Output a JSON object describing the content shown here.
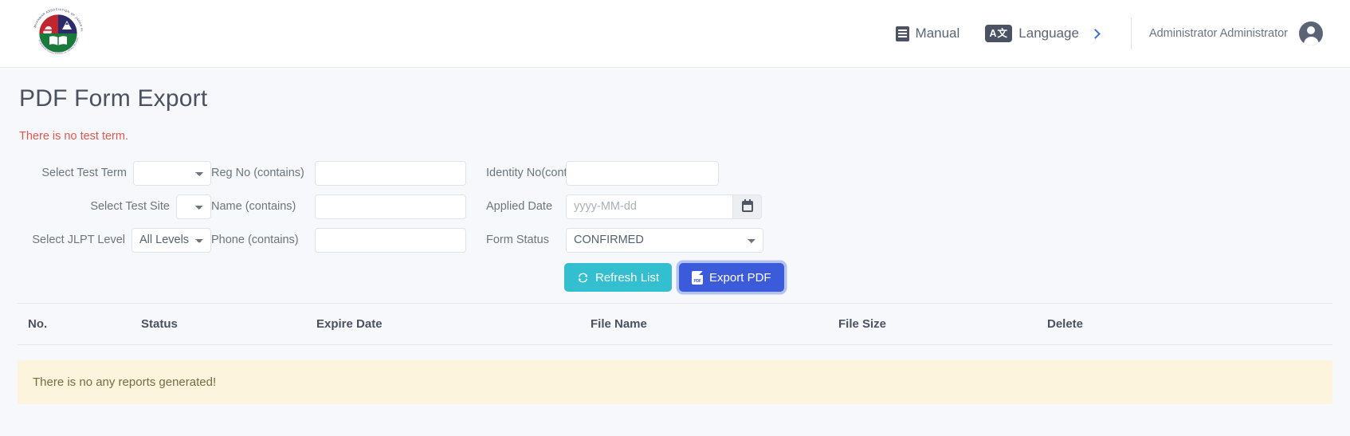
{
  "navbar": {
    "logo_alt": "Myanmar Association of Japan Alumni",
    "manual_label": "Manual",
    "language_label": "Language",
    "language_icon_text": "A文",
    "user_name": "Administrator Administrator"
  },
  "page": {
    "title": "PDF Form Export",
    "warning": "There is no test term."
  },
  "filters": {
    "test_term": {
      "label": "Select Test Term",
      "value": "",
      "options": [
        ""
      ]
    },
    "reg_no": {
      "label": "Reg No (contains)",
      "value": "",
      "placeholder": ""
    },
    "identity_no": {
      "label": "Identity No(contains)",
      "value": "",
      "placeholder": ""
    },
    "test_site": {
      "label": "Select Test Site",
      "value": "",
      "options": [
        ""
      ]
    },
    "name": {
      "label": "Name (contains)",
      "value": "",
      "placeholder": ""
    },
    "applied_date": {
      "label": "Applied Date",
      "value": "",
      "placeholder": "yyyy-MM-dd"
    },
    "jlpt_level": {
      "label": "Select JLPT Level",
      "value": "All Levels",
      "options": [
        "All Levels"
      ]
    },
    "phone": {
      "label": "Phone (contains)",
      "value": "",
      "placeholder": ""
    },
    "form_status": {
      "label": "Form Status",
      "value": "CONFIRMED",
      "options": [
        "CONFIRMED"
      ]
    }
  },
  "actions": {
    "refresh_label": "Refresh List",
    "export_label": "Export PDF"
  },
  "table": {
    "columns": [
      "No.",
      "Status",
      "Expire Date",
      "File Name",
      "File Size",
      "Delete"
    ],
    "rows": [],
    "empty_message": "There is no any reports generated!"
  },
  "colors": {
    "accent_teal": "#34bfd0",
    "accent_blue": "#3b5bdb",
    "warning_red": "#e2574c",
    "alert_bg": "#fcf4dc",
    "page_bg": "#f7f8fb"
  }
}
